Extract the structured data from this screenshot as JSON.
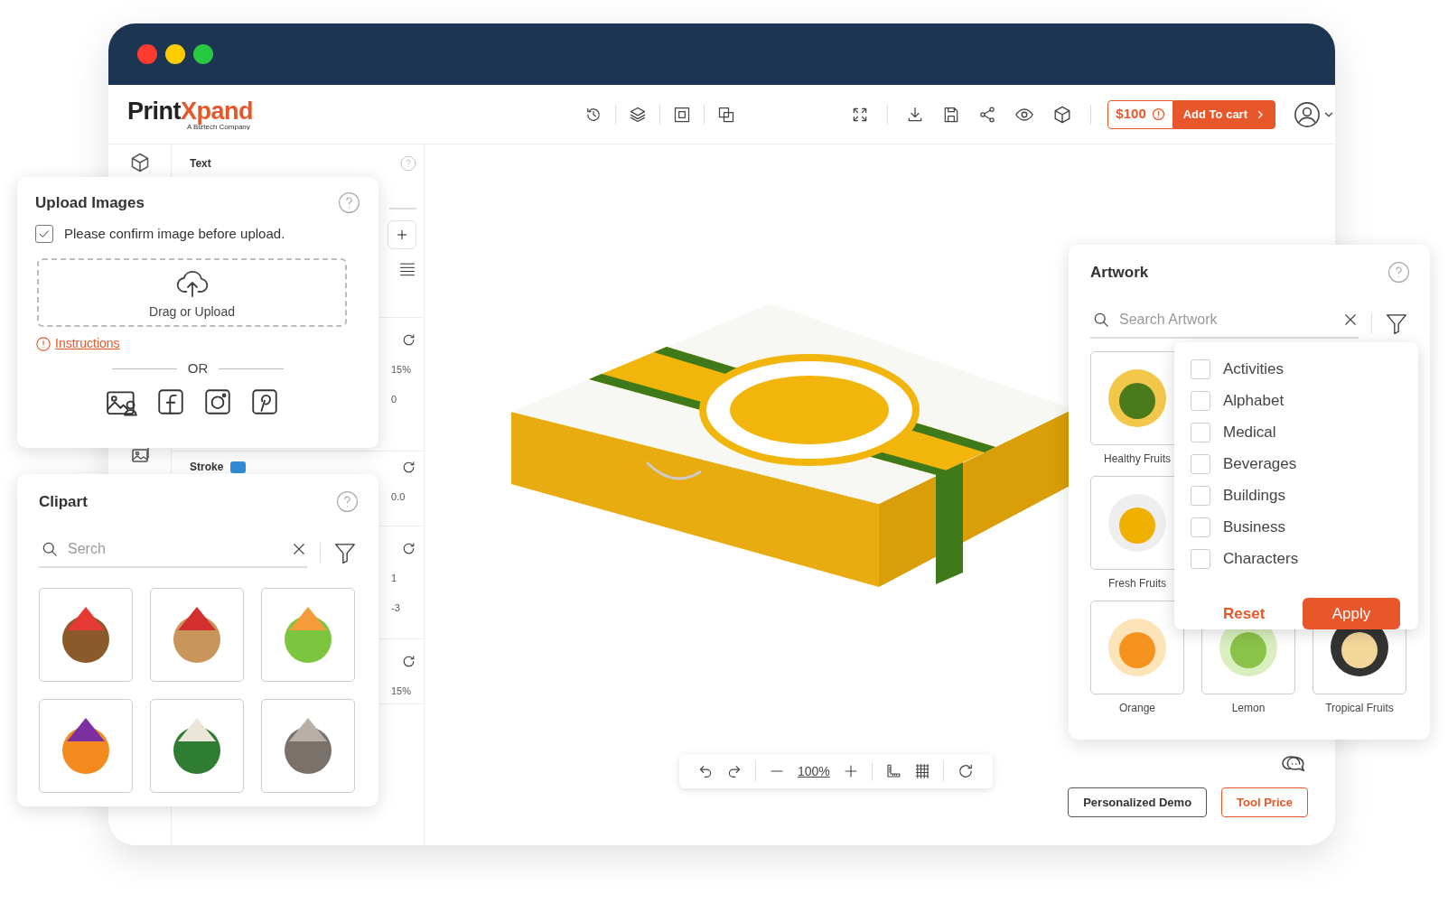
{
  "window": {
    "title_bar": {
      "buttons": [
        {
          "color": "#ff3b30"
        },
        {
          "color": "#ffcc00"
        },
        {
          "color": "#28c840"
        }
      ]
    }
  },
  "header": {
    "logo": {
      "dark": "Print",
      "accent": "Xpand",
      "tagline": "A Biztech Company"
    },
    "price": "$100",
    "add_to_cart": "Add To cart"
  },
  "properties": {
    "sections": [
      {
        "label": "Text"
      },
      {
        "values": [
          "15%",
          "0"
        ]
      },
      {
        "label": "Stroke",
        "color": "#2f8fd8",
        "values": [
          "0.0"
        ]
      },
      {
        "values": [
          "1",
          "-3"
        ]
      },
      {
        "values": [
          "15%"
        ]
      }
    ]
  },
  "upload_panel": {
    "title": "Upload Images",
    "confirm": {
      "label": "Please confirm image before upload.",
      "checked": true
    },
    "dropzone": "Drag or Upload",
    "instructions": "Instructions",
    "divider": "OR"
  },
  "clipart_panel": {
    "title": "Clipart",
    "search": {
      "placeholder": "Serch"
    }
  },
  "artwork_panel": {
    "title": "Artwork",
    "search": {
      "placeholder": "Search Artwork"
    },
    "rows": [
      [
        {
          "caption": "Healthy Fruits"
        }
      ],
      [
        {
          "caption": "Fresh Fruits"
        }
      ],
      [
        {
          "caption": "Orange"
        },
        {
          "caption": "Lemon"
        },
        {
          "caption": "Tropical Fruits"
        }
      ]
    ],
    "filter": {
      "options": [
        {
          "label": "Activities",
          "checked": false
        },
        {
          "label": "Alphabet",
          "checked": false
        },
        {
          "label": "Medical",
          "checked": false
        },
        {
          "label": "Beverages",
          "checked": false
        },
        {
          "label": "Buildings",
          "checked": false
        },
        {
          "label": "Business",
          "checked": false
        },
        {
          "label": "Characters",
          "checked": false
        }
      ],
      "reset": "Reset",
      "apply": "Apply"
    }
  },
  "canvas": {
    "zoom": "100%",
    "buttons": [
      {
        "label": "Personalized Demo",
        "kind": "outline"
      },
      {
        "label": "Tool Price",
        "kind": "accent"
      }
    ]
  }
}
